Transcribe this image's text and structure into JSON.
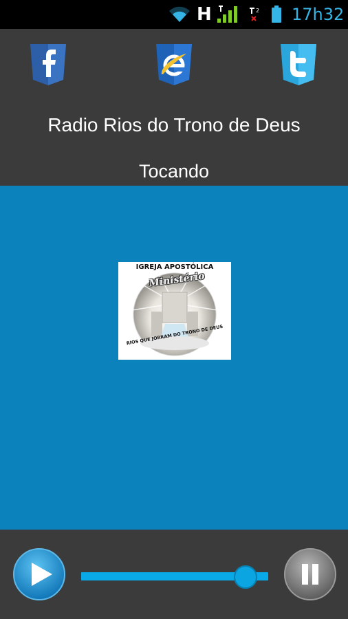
{
  "status_bar": {
    "network_type": "H",
    "time": "17h32",
    "icons": [
      "wifi-icon",
      "signal-icon",
      "sim-off-icon",
      "battery-icon"
    ]
  },
  "header": {
    "social_links": [
      {
        "name": "facebook",
        "icon": "facebook-icon"
      },
      {
        "name": "internet-explorer",
        "icon": "internet-explorer-icon"
      },
      {
        "name": "twitter",
        "icon": "twitter-icon"
      }
    ],
    "title": "Radio Rios do Trono de Deus",
    "status": "Tocando"
  },
  "artwork": {
    "heading": "IGREJA APOSTÓLICA",
    "subtitle": "Ministério",
    "tagline": "RIOS QUE JORRAM DO TRONO DE DEUS"
  },
  "player": {
    "play_icon": "play-icon",
    "pause_icon": "pause-icon",
    "volume_level": 0.88
  },
  "colors": {
    "main_background": "#0c82bd",
    "accent": "#35b5e5",
    "chrome": "#3b3b3b"
  }
}
